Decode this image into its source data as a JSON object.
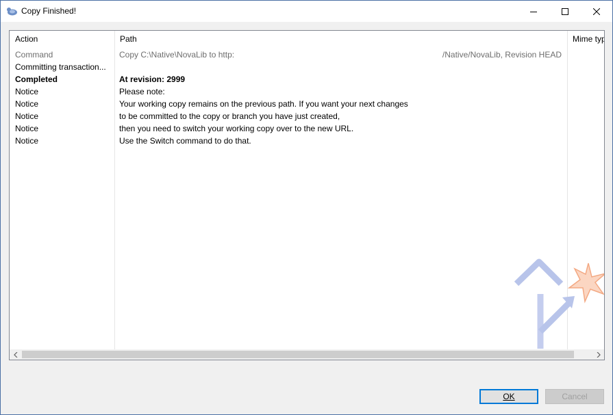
{
  "window": {
    "title": "Copy Finished!",
    "app_icon": "tortoise-icon",
    "controls": {
      "minimize": "minimize-icon",
      "maximize": "maximize-icon",
      "close": "close-icon"
    }
  },
  "list": {
    "columns": [
      "Action",
      "Path",
      "Mime typ"
    ],
    "rows": [
      {
        "action": "Command",
        "path": "Copy C:\\Native\\NovaLib to http:",
        "path_right": "/Native/NovaLib, Revision HEAD",
        "style": "gray"
      },
      {
        "action": "Committing transaction...",
        "path": "",
        "path_right": "",
        "style": "normal"
      },
      {
        "action": "Completed",
        "path": "At revision: 2999",
        "path_right": "",
        "style": "bold"
      },
      {
        "action": "Notice",
        "path": "Please note:",
        "path_right": "",
        "style": "normal"
      },
      {
        "action": "Notice",
        "path": "Your working copy remains on the previous path. If you want your next changes",
        "path_right": "",
        "style": "normal"
      },
      {
        "action": "Notice",
        "path": "to be committed to the copy or branch you have just created,",
        "path_right": "",
        "style": "normal"
      },
      {
        "action": "Notice",
        "path": "then you need to switch your working copy over to the new URL.",
        "path_right": "",
        "style": "normal"
      },
      {
        "action": "Notice",
        "path": "Use the Switch command to do that.",
        "path_right": "",
        "style": "normal"
      }
    ],
    "watermark": "branch-copy-icon"
  },
  "buttons": {
    "ok": "OK",
    "cancel": "Cancel"
  },
  "colors": {
    "accent": "#0078d7",
    "watermark_arrow": "#b8c4ea",
    "watermark_star": "#f7c9b0"
  }
}
